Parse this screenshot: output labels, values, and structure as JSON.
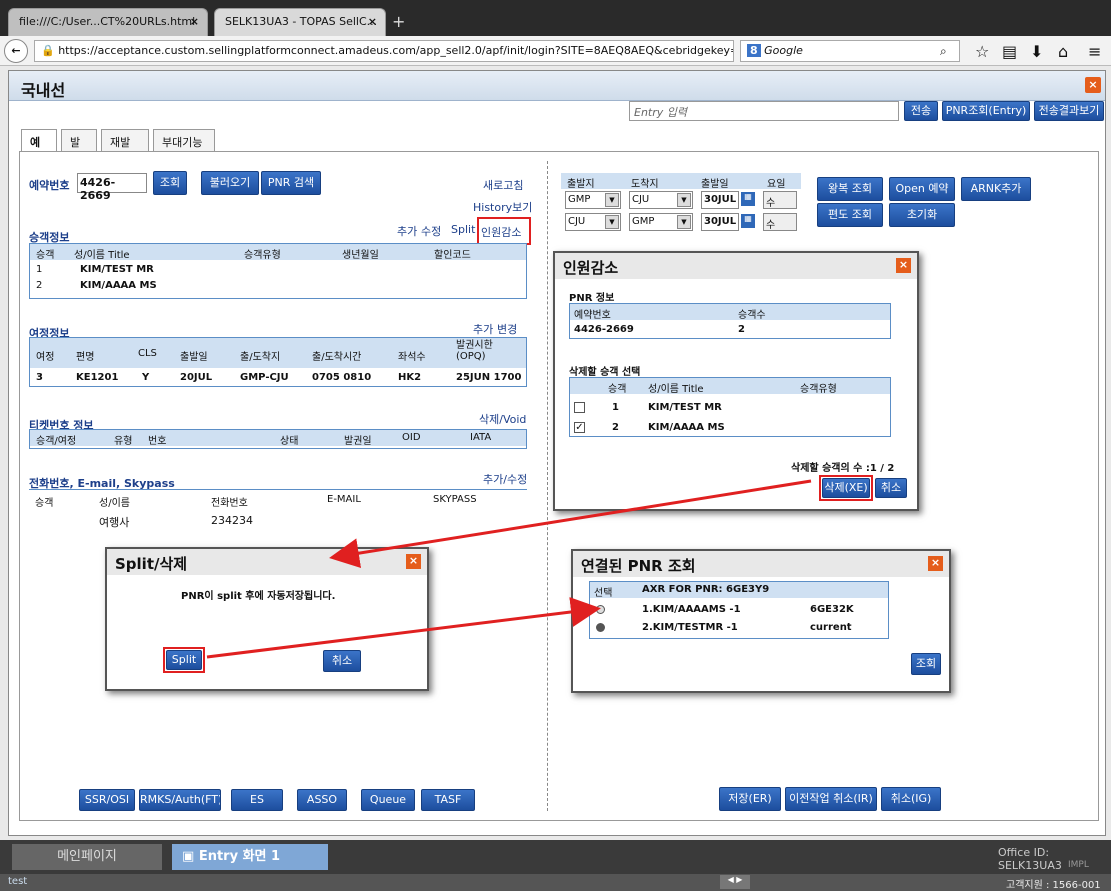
{
  "browser": {
    "tab1": "file:///C:/User...CT%20URLs.html",
    "tab2": "SELK13UA3 - TOPAS SellC...",
    "url": "https://acceptance.custom.sellingplatformconnect.amadeus.com/app_sell2.0/apf/init/login?SITE=8AEQ8AEQ&cebridgekey=WJUNG_SOU",
    "search_placeholder": "Google"
  },
  "app": {
    "title": "국내선",
    "entry_placeholder": "Entry 입력",
    "send_btn": "전송",
    "pnr_entry_btn": "PNR조회(Entry)",
    "result_btn": "전송결과보기",
    "tabs": [
      "예약",
      "발권",
      "재발행",
      "부대기능"
    ]
  },
  "left": {
    "booking_label": "예약번호",
    "booking_no": "4426-2669",
    "btn_search": "조회",
    "btn_load": "불러오기",
    "btn_pnr_search": "PNR 검색",
    "refresh": "새로고침",
    "history": "History보기",
    "pax": {
      "title": "승객정보",
      "actions": [
        "추가",
        "수정",
        "Split",
        "인원감소"
      ],
      "headers": [
        "승객",
        "성/이름 Title",
        "승객유형",
        "생년월일",
        "할인코드"
      ],
      "rows": [
        [
          "1",
          "KIM/TEST MR"
        ],
        [
          "2",
          "KIM/AAAA MS"
        ]
      ]
    },
    "itin": {
      "title": "여정정보",
      "actions": [
        "추가",
        "변경"
      ],
      "headers": [
        "여정",
        "편명",
        "CLS",
        "출발일",
        "출/도착지",
        "출/도착시간",
        "좌석수",
        "발권시한 (OPQ)"
      ],
      "row": [
        "3",
        "KE1201",
        "Y",
        "20JUL",
        "GMP-CJU",
        "0705 0810",
        "HK2",
        "25JUN 1700"
      ]
    },
    "ticket": {
      "title": "티켓번호 정보",
      "action": "삭제/Void",
      "headers": [
        "승객/여정",
        "유형",
        "번호",
        "상태",
        "발권일",
        "OID",
        "IATA"
      ]
    },
    "contact": {
      "title": "전화번호, E-mail, Skypass",
      "action": "추가/수정",
      "headers": [
        "승객",
        "성/이름",
        "전화번호",
        "E-MAIL",
        "SKYPASS"
      ],
      "row": [
        "여행사",
        "234234"
      ]
    },
    "bottom_btns": [
      "SSR/OSI",
      "RMKS/Auth(FT)",
      "ES",
      "ASSO",
      "Queue",
      "TASF"
    ]
  },
  "right": {
    "flight_headers": [
      "출발지",
      "도착지",
      "출발일",
      "요일"
    ],
    "flights": [
      [
        "GMP",
        "CJU",
        "30JUL",
        "수"
      ],
      [
        "CJU",
        "GMP",
        "30JUL",
        "수"
      ]
    ],
    "btns": [
      "왕복 조회",
      "Open 예약",
      "ARNK추가",
      "편도 조회",
      "초기화"
    ],
    "bottom_btns": [
      "저장(ER)",
      "이전작업 취소(IR)",
      "취소(IG)"
    ]
  },
  "dlg_reduce": {
    "title": "인원감소",
    "pnr_section": "PNR 정보",
    "pnr_headers": [
      "예약번호",
      "승객수"
    ],
    "pnr_row": [
      "4426-2669",
      "2"
    ],
    "select_section": "삭제할 승객 선택",
    "headers": [
      "승객",
      "성/이름 Title",
      "승객유형"
    ],
    "rows": [
      [
        "1",
        "KIM/TEST MR"
      ],
      [
        "2",
        "KIM/AAAA MS"
      ]
    ],
    "count_text": "삭제할 승객의 수 :1 / 2",
    "btn_delete": "삭제(XE)",
    "btn_cancel": "취소"
  },
  "dlg_split": {
    "title": "Split/삭제",
    "message": "PNR이 split 후에 자동저장됩니다.",
    "btn_split": "Split",
    "btn_cancel": "취소"
  },
  "dlg_linked": {
    "title": "연결된 PNR 조회",
    "headers": [
      "선택",
      "AXR FOR PNR: 6GE3Y9"
    ],
    "rows": [
      [
        "1.KIM/AAAAMS -1",
        "6GE32K"
      ],
      [
        "2.KIM/TESTMR -1",
        "current"
      ]
    ],
    "btn_search": "조회"
  },
  "taskbar": {
    "main_page": "메인페이지",
    "entry_screen": "Entry 화면 1",
    "office_id": "Office ID: SELK13UA3",
    "impl": "IMPL",
    "status_left": "test",
    "support": "고객지원 : 1566-001"
  },
  "colors": {
    "accent": "#1d4e9e",
    "highlight": "#e02020",
    "close": "#e55d1b"
  }
}
